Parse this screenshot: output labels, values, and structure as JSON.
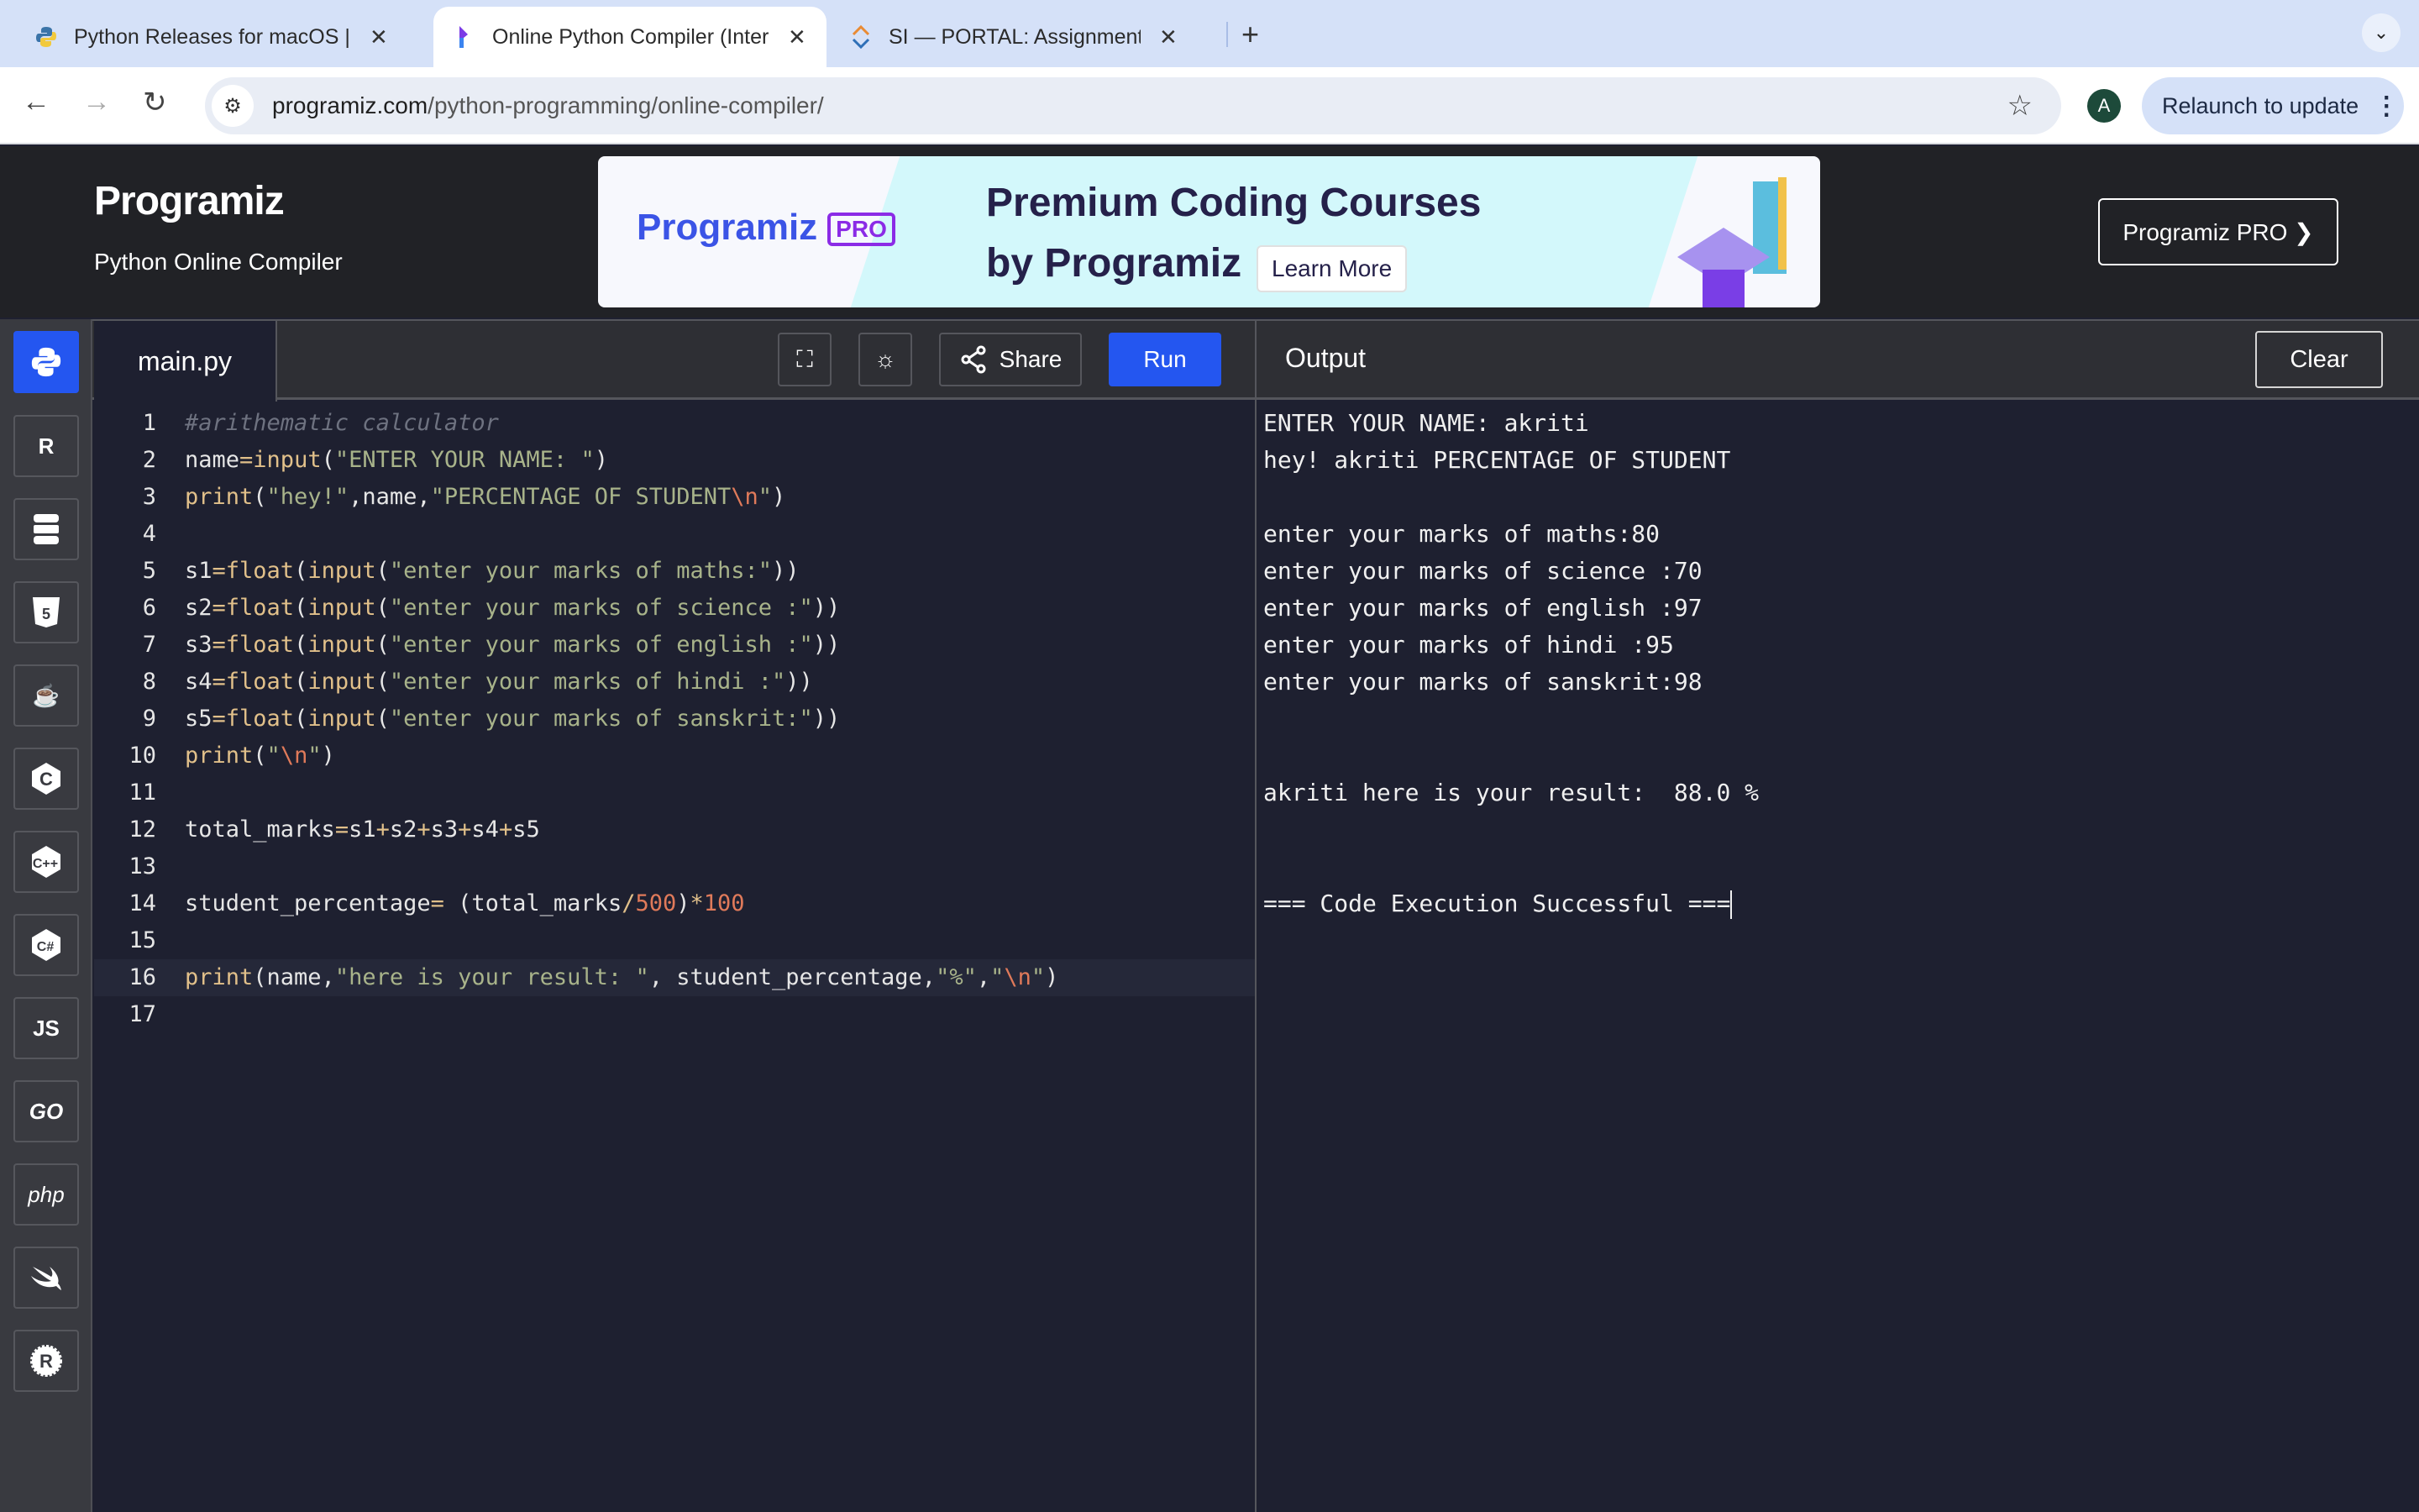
{
  "browser": {
    "tabs": [
      {
        "title": "Python Releases for macOS |",
        "icon": "python-logo-icon",
        "active": false
      },
      {
        "title": "Online Python Compiler (Inter",
        "icon": "programiz-logo-icon",
        "active": true
      },
      {
        "title": "SI — PORTAL: Assignment Su",
        "icon": "portal-logo-icon",
        "active": false
      }
    ],
    "new_tab": "+",
    "tab_menu": "⌄",
    "url_domain": "programiz.com",
    "url_path": "/python-programming/online-compiler/",
    "avatar_letter": "A",
    "relaunch_label": "Relaunch to update"
  },
  "site": {
    "logo": "Programiz",
    "subtitle": "Python Online Compiler",
    "banner": {
      "brand": "Programiz",
      "badge": "PRO",
      "headline1": "Premium Coding Courses",
      "headline2": "by Programiz",
      "cta": "Learn More"
    },
    "pro_button": "Programiz PRO ❯"
  },
  "sidebar": {
    "languages": [
      {
        "name": "python",
        "label": "",
        "active": true
      },
      {
        "name": "r",
        "label": "R"
      },
      {
        "name": "sql",
        "label": ""
      },
      {
        "name": "html",
        "label": "5"
      },
      {
        "name": "java",
        "label": "☕"
      },
      {
        "name": "c",
        "label": "C"
      },
      {
        "name": "cpp",
        "label": "C++"
      },
      {
        "name": "csharp",
        "label": "C#"
      },
      {
        "name": "javascript",
        "label": "JS"
      },
      {
        "name": "go",
        "label": "GO"
      },
      {
        "name": "php",
        "label": "php"
      },
      {
        "name": "swift",
        "label": ""
      },
      {
        "name": "rust",
        "label": "R"
      }
    ]
  },
  "editor": {
    "file_name": "main.py",
    "share_label": "Share",
    "run_label": "Run",
    "current_line": 16,
    "lines": [
      [
        {
          "t": "#arithematic calculator",
          "c": "cm"
        }
      ],
      [
        {
          "t": "name",
          "c": "tx"
        },
        {
          "t": "=",
          "c": "op"
        },
        {
          "t": "input",
          "c": "fn"
        },
        {
          "t": "(",
          "c": "tx"
        },
        {
          "t": "\"ENTER YOUR NAME: \"",
          "c": "st"
        },
        {
          "t": ")",
          "c": "tx"
        }
      ],
      [
        {
          "t": "print",
          "c": "fn"
        },
        {
          "t": "(",
          "c": "tx"
        },
        {
          "t": "\"hey!\"",
          "c": "st"
        },
        {
          "t": ",name,",
          "c": "tx"
        },
        {
          "t": "\"PERCENTAGE OF STUDENT",
          "c": "st"
        },
        {
          "t": "\\n",
          "c": "es"
        },
        {
          "t": "\"",
          "c": "st"
        },
        {
          "t": ")",
          "c": "tx"
        }
      ],
      [],
      [
        {
          "t": "s1",
          "c": "tx"
        },
        {
          "t": "=",
          "c": "op"
        },
        {
          "t": "float",
          "c": "fn"
        },
        {
          "t": "(",
          "c": "tx"
        },
        {
          "t": "input",
          "c": "fn"
        },
        {
          "t": "(",
          "c": "tx"
        },
        {
          "t": "\"enter your marks of maths:\"",
          "c": "st"
        },
        {
          "t": "))",
          "c": "tx"
        }
      ],
      [
        {
          "t": "s2",
          "c": "tx"
        },
        {
          "t": "=",
          "c": "op"
        },
        {
          "t": "float",
          "c": "fn"
        },
        {
          "t": "(",
          "c": "tx"
        },
        {
          "t": "input",
          "c": "fn"
        },
        {
          "t": "(",
          "c": "tx"
        },
        {
          "t": "\"enter your marks of science :\"",
          "c": "st"
        },
        {
          "t": "))",
          "c": "tx"
        }
      ],
      [
        {
          "t": "s3",
          "c": "tx"
        },
        {
          "t": "=",
          "c": "op"
        },
        {
          "t": "float",
          "c": "fn"
        },
        {
          "t": "(",
          "c": "tx"
        },
        {
          "t": "input",
          "c": "fn"
        },
        {
          "t": "(",
          "c": "tx"
        },
        {
          "t": "\"enter your marks of english :\"",
          "c": "st"
        },
        {
          "t": "))",
          "c": "tx"
        }
      ],
      [
        {
          "t": "s4",
          "c": "tx"
        },
        {
          "t": "=",
          "c": "op"
        },
        {
          "t": "float",
          "c": "fn"
        },
        {
          "t": "(",
          "c": "tx"
        },
        {
          "t": "input",
          "c": "fn"
        },
        {
          "t": "(",
          "c": "tx"
        },
        {
          "t": "\"enter your marks of hindi :\"",
          "c": "st"
        },
        {
          "t": "))",
          "c": "tx"
        }
      ],
      [
        {
          "t": "s5",
          "c": "tx"
        },
        {
          "t": "=",
          "c": "op"
        },
        {
          "t": "float",
          "c": "fn"
        },
        {
          "t": "(",
          "c": "tx"
        },
        {
          "t": "input",
          "c": "fn"
        },
        {
          "t": "(",
          "c": "tx"
        },
        {
          "t": "\"enter your marks of sanskrit:\"",
          "c": "st"
        },
        {
          "t": "))",
          "c": "tx"
        }
      ],
      [
        {
          "t": "print",
          "c": "fn"
        },
        {
          "t": "(",
          "c": "tx"
        },
        {
          "t": "\"",
          "c": "st"
        },
        {
          "t": "\\n",
          "c": "es"
        },
        {
          "t": "\"",
          "c": "st"
        },
        {
          "t": ")",
          "c": "tx"
        }
      ],
      [],
      [
        {
          "t": "total_marks",
          "c": "tx"
        },
        {
          "t": "=",
          "c": "op"
        },
        {
          "t": "s1",
          "c": "tx"
        },
        {
          "t": "+",
          "c": "op"
        },
        {
          "t": "s2",
          "c": "tx"
        },
        {
          "t": "+",
          "c": "op"
        },
        {
          "t": "s3",
          "c": "tx"
        },
        {
          "t": "+",
          "c": "op"
        },
        {
          "t": "s4",
          "c": "tx"
        },
        {
          "t": "+",
          "c": "op"
        },
        {
          "t": "s5",
          "c": "tx"
        }
      ],
      [],
      [
        {
          "t": "student_percentage",
          "c": "tx"
        },
        {
          "t": "=",
          "c": "op"
        },
        {
          "t": " (total_marks",
          "c": "tx"
        },
        {
          "t": "/",
          "c": "op"
        },
        {
          "t": "500",
          "c": "nu"
        },
        {
          "t": ")",
          "c": "tx"
        },
        {
          "t": "*",
          "c": "op"
        },
        {
          "t": "100",
          "c": "nu"
        }
      ],
      [],
      [
        {
          "t": "print",
          "c": "fn"
        },
        {
          "t": "(name,",
          "c": "tx"
        },
        {
          "t": "\"here is your result: \"",
          "c": "st"
        },
        {
          "t": ", student_percentage,",
          "c": "tx"
        },
        {
          "t": "\"%\"",
          "c": "st"
        },
        {
          "t": ",",
          "c": "tx"
        },
        {
          "t": "\"",
          "c": "st"
        },
        {
          "t": "\\n",
          "c": "es"
        },
        {
          "t": "\"",
          "c": "st"
        },
        {
          "t": ")",
          "c": "tx"
        }
      ],
      []
    ]
  },
  "output": {
    "title": "Output",
    "clear_label": "Clear",
    "lines": [
      "ENTER YOUR NAME: akriti",
      "hey! akriti PERCENTAGE OF STUDENT",
      "",
      "enter your marks of maths:80",
      "enter your marks of science :70",
      "enter your marks of english :97",
      "enter your marks of hindi :95",
      "enter your marks of sanskrit:98",
      "",
      "",
      "akriti here is your result:  88.0 %",
      "",
      "",
      "=== Code Execution Successful ==="
    ]
  }
}
